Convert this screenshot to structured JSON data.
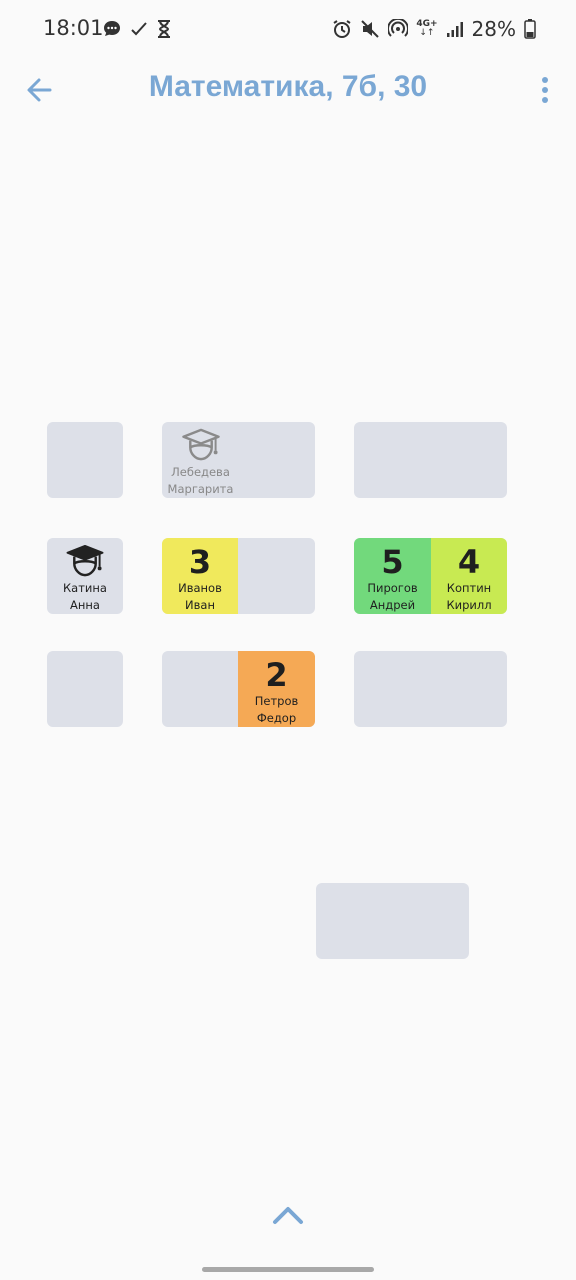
{
  "status_bar": {
    "time": "18:01",
    "left_icons": [
      "message-icon",
      "check-icon",
      "hourglass-icon"
    ],
    "right_icons": [
      "alarm-icon",
      "mute-icon",
      "hotspot-icon",
      "network-4g-icon",
      "signal-icon"
    ],
    "network_label": "4G+",
    "battery_percent": "28%"
  },
  "app_bar": {
    "title": "Математика, 7б, 30",
    "back_icon": "arrow-left-icon",
    "menu_icon": "more-vert-icon"
  },
  "colors": {
    "accent": "#7aa7d4",
    "desk_empty": "#dde0e8",
    "grade_5": "#72d97c",
    "grade_4": "#c8ea52",
    "grade_3": "#f0e95c",
    "grade_2": "#f5a955"
  },
  "desks": {
    "r1c2_left": {
      "surname": "Лебедева",
      "first_name": "Маргарита",
      "icon": "graduation-cap-icon",
      "absent": true
    },
    "r2c1_left": {
      "surname": "Катина",
      "first_name": "Анна",
      "icon": "graduation-cap-icon"
    },
    "r2c2_left": {
      "grade": "3",
      "surname": "Иванов",
      "first_name": "Иван"
    },
    "r2c3_left": {
      "grade": "5",
      "surname": "Пирогов",
      "first_name": "Андрей"
    },
    "r2c3_right": {
      "grade": "4",
      "surname": "Коптин",
      "first_name": "Кирилл"
    },
    "r3c2_right": {
      "grade": "2",
      "surname": "Петров",
      "first_name": "Федор"
    }
  },
  "bottom": {
    "expand_icon": "chevron-up-icon"
  }
}
